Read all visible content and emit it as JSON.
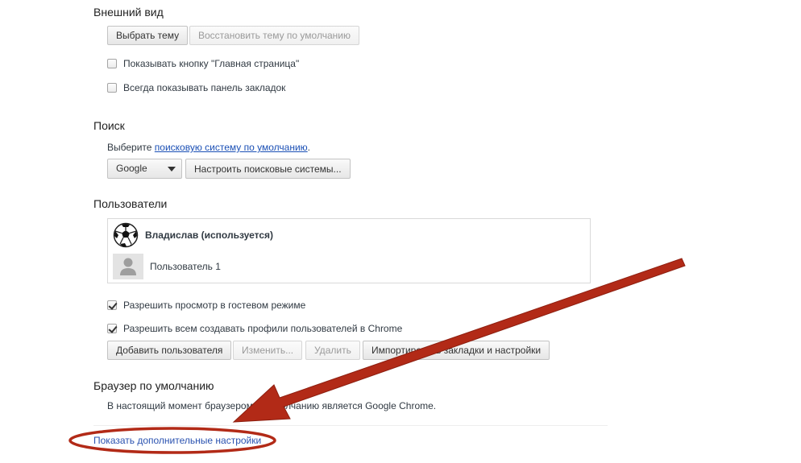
{
  "appearance": {
    "title": "Внешний вид",
    "choose_theme": "Выбрать тему",
    "reset_theme": "Восстановить тему по умолчанию",
    "show_home_button": "Показывать кнопку \"Главная страница\"",
    "show_bookmarks_bar": "Всегда показывать панель закладок"
  },
  "search": {
    "title": "Поиск",
    "prompt_prefix": "Выберите ",
    "prompt_link": "поисковую систему по умолчанию",
    "prompt_suffix": ".",
    "engine_selected": "Google",
    "manage_button": "Настроить поисковые системы..."
  },
  "users": {
    "title": "Пользователи",
    "list": [
      {
        "name": "Владислав (используется)",
        "active": true,
        "avatar_icon": "soccer-ball-icon"
      },
      {
        "name": "Пользователь 1",
        "active": false,
        "avatar_icon": "default-person-icon"
      }
    ],
    "allow_guest": "Разрешить просмотр в гостевом режиме",
    "allow_profiles": "Разрешить всем создавать профили пользователей в Chrome",
    "add_user": "Добавить пользователя",
    "edit": "Изменить...",
    "delete": "Удалить",
    "import": "Импортировать закладки и настройки"
  },
  "default_browser": {
    "title": "Браузер по умолчанию",
    "status": "В настоящий момент браузером по умолчанию является Google Chrome."
  },
  "show_advanced_link": "Показать дополнительные настройки",
  "annotation": {
    "arrow_color": "#b22a17",
    "ellipse_color": "#b22a17"
  }
}
